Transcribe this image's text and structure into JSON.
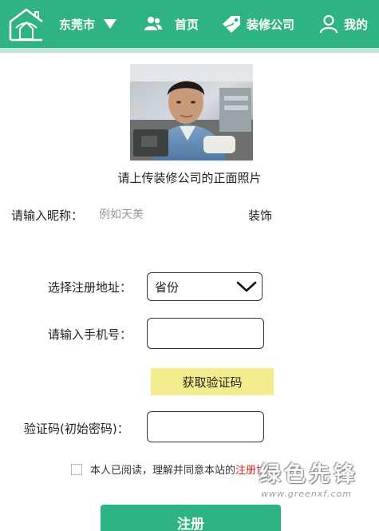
{
  "header": {
    "city": "东莞市",
    "nav": [
      {
        "label": "首页",
        "icon": "users-icon"
      },
      {
        "label": "装修公司",
        "icon": "tag-icon"
      },
      {
        "label": "我的",
        "icon": "user-icon"
      }
    ],
    "brand_color": "#2fb383"
  },
  "upload": {
    "caption": "请上传装修公司的正面照片"
  },
  "form": {
    "nickname_label": "请输入昵称：",
    "nickname_placeholder": "例如天美",
    "nickname_suffix": "装饰",
    "address_label": "选择注册地址：",
    "address_value": "省份",
    "phone_label": "请输入手机号：",
    "phone_value": "",
    "get_code_label": "获取验证码",
    "code_label": "验证码(初始密码)：",
    "code_value": "",
    "agree_text": "本人已阅读，理解并同意本站的",
    "agree_link": "注册协议",
    "agree_checked": false,
    "register_label": "注册"
  },
  "watermark": {
    "text": "绿色先锋",
    "url": "www.greenxf.com"
  },
  "colors": {
    "accent": "#2fb383",
    "code_button": "#f2ec8c",
    "link": "#e02020"
  }
}
